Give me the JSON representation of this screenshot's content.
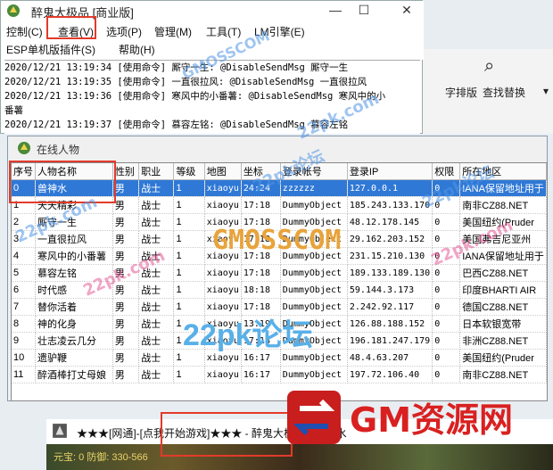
{
  "main_window": {
    "title": "醉鬼大极品 [商业版]",
    "controls": {
      "minimize": "—",
      "maximize": "☐",
      "close": "✕"
    },
    "menu_row1": [
      "控制(C)",
      "查看(V)",
      "选项(P)",
      "管理(M)",
      "工具(T)",
      "LM引擎(E)"
    ],
    "menu_row2": [
      "ESP单机版插件(S)",
      "帮助(H)"
    ],
    "log_lines": [
      "2020/12/21 13:19:34 [使用命令] 厮守一生: @DisableSendMsg 厮守一生",
      "2020/12/21 13:19:35 [使用命令] 一直很拉风: @DisableSendMsg 一直很拉风",
      "2020/12/21 13:19:36 [使用命令] 寒风中的小番薯: @DisableSendMsg 寒风中的小",
      "番薯",
      "2020/12/21 13:19:37 [使用命令] 慕容左铭: @DisableSendMsg 慕容左铭"
    ]
  },
  "ribbon": {
    "label1": "字排版",
    "label2": "查找替换",
    "more": "▾"
  },
  "online_window": {
    "title": "在线人物",
    "columns": [
      "序号",
      "人物名称",
      "性别",
      "职业",
      "等级",
      "地图",
      "坐标",
      "登录帐号",
      "登录IP",
      "权限",
      "所在地区"
    ],
    "rows": [
      [
        "0",
        "兽神水",
        "男",
        "战士",
        "1",
        "xiaoyu",
        "24:24",
        "zzzzzz",
        "127.0.0.1",
        "0",
        "IANA保留地址用于"
      ],
      [
        "1",
        "天天精彩",
        "男",
        "战士",
        "1",
        "xiaoyu",
        "17:18",
        "DummyObject",
        "185.243.133.170",
        "0",
        "南非CZ88.NET"
      ],
      [
        "2",
        "厮守一生",
        "男",
        "战士",
        "1",
        "xiaoyu",
        "17:18",
        "DummyObject",
        "48.12.178.145",
        "0",
        "美国纽约(Pruder"
      ],
      [
        "3",
        "一直很拉风",
        "男",
        "战士",
        "1",
        "xiaoyu",
        "17:18",
        "DummyObject",
        "29.162.203.152",
        "0",
        "美国弗吉尼亚州"
      ],
      [
        "4",
        "寒风中的小番薯",
        "男",
        "战士",
        "1",
        "xiaoyu",
        "17:18",
        "DummyObject",
        "231.15.210.130",
        "0",
        "IANA保留地址用于"
      ],
      [
        "5",
        "慕容左铭",
        "男",
        "战士",
        "1",
        "xiaoyu",
        "17:18",
        "DummyObject",
        "189.133.189.130",
        "0",
        "巴西CZ88.NET"
      ],
      [
        "6",
        "时代感",
        "男",
        "战士",
        "1",
        "xiaoyu",
        "18:18",
        "DummyObject",
        "59.144.3.173",
        "0",
        "印度BHARTI AIR"
      ],
      [
        "7",
        "替你活着",
        "男",
        "战士",
        "1",
        "xiaoyu",
        "17:18",
        "DummyObject",
        "2.242.92.117",
        "0",
        "德国CZ88.NET"
      ],
      [
        "8",
        "神的化身",
        "男",
        "战士",
        "1",
        "xiaoyu",
        "13:19",
        "DummyObject",
        "126.88.188.152",
        "0",
        "日本软银宽带"
      ],
      [
        "9",
        "壮志凌云几分",
        "男",
        "战士",
        "1",
        "xiaoyu",
        "17:18",
        "DummyObject",
        "196.181.247.179",
        "0",
        "非洲CZ88.NET"
      ],
      [
        "10",
        "遗驴鞭",
        "男",
        "战士",
        "1",
        "xiaoyu",
        "16:17",
        "DummyObject",
        "48.4.63.207",
        "0",
        "美国纽约(Pruder"
      ],
      [
        "11",
        "醉酒棒打丈母娘",
        "男",
        "战士",
        "1",
        "xiaoyu",
        "16:17",
        "DummyObject",
        "197.72.106.40",
        "0",
        "南非CZ88.NET"
      ]
    ]
  },
  "bottom": {
    "window_text": "★★★[网通]-[点我开始游戏]★★★ - 醉鬼大极品 - 兽神水",
    "game_text": "元宝: 0 防御: 330-566"
  },
  "watermarks": {
    "gm": "GM资源网",
    "center": "GMOSSCOM",
    "forum": "22pk论坛",
    "small": "22pk.com"
  },
  "colors": {
    "selection": "#2f78d6",
    "highlight": "#e23b2a",
    "gm_red": "#d92020"
  }
}
